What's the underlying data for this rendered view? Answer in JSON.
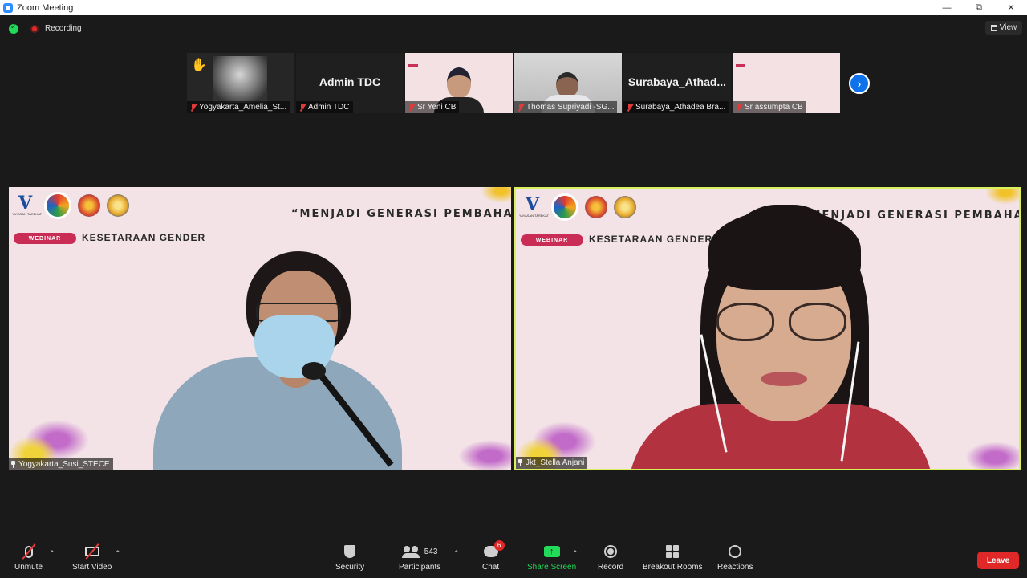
{
  "window": {
    "title": "Zoom Meeting"
  },
  "status": {
    "recording_label": "Recording",
    "view_label": "View"
  },
  "thumbnails": [
    {
      "name": "Yogyakarta_Amelia_St..."
    },
    {
      "name": "Admin TDC",
      "display": "Admin TDC"
    },
    {
      "name": "Sr Yeni CB"
    },
    {
      "name": "Thomas Supriyadi -SG..."
    },
    {
      "name": "Surabaya_Athadea Bra...",
      "display": "Surabaya_Athad..."
    },
    {
      "name": "Sr assumpta CB"
    }
  ],
  "slide": {
    "slogan": "“MENJADI GENERASI PEMBAHARU MASA KINI”",
    "webinar": "WEBINAR",
    "topic": "KESETARAAN GENDER",
    "org": "YAYASAN TAREKAT"
  },
  "tiles": [
    {
      "name": "Yogyakarta_Susi_STECE"
    },
    {
      "name": "Jkt_Stella Anjani"
    }
  ],
  "toolbar": {
    "unmute": "Unmute",
    "start_video": "Start Video",
    "security": "Security",
    "participants": "Participants",
    "participants_count": "543",
    "chat": "Chat",
    "chat_badge": "6",
    "share_screen": "Share Screen",
    "record": "Record",
    "breakout_rooms": "Breakout Rooms",
    "reactions": "Reactions",
    "leave": "Leave"
  },
  "colors": {
    "accent": "#2d8cff",
    "share_green": "#23d959",
    "leave_red": "#e02828",
    "active_speaker": "#d7f05b"
  }
}
